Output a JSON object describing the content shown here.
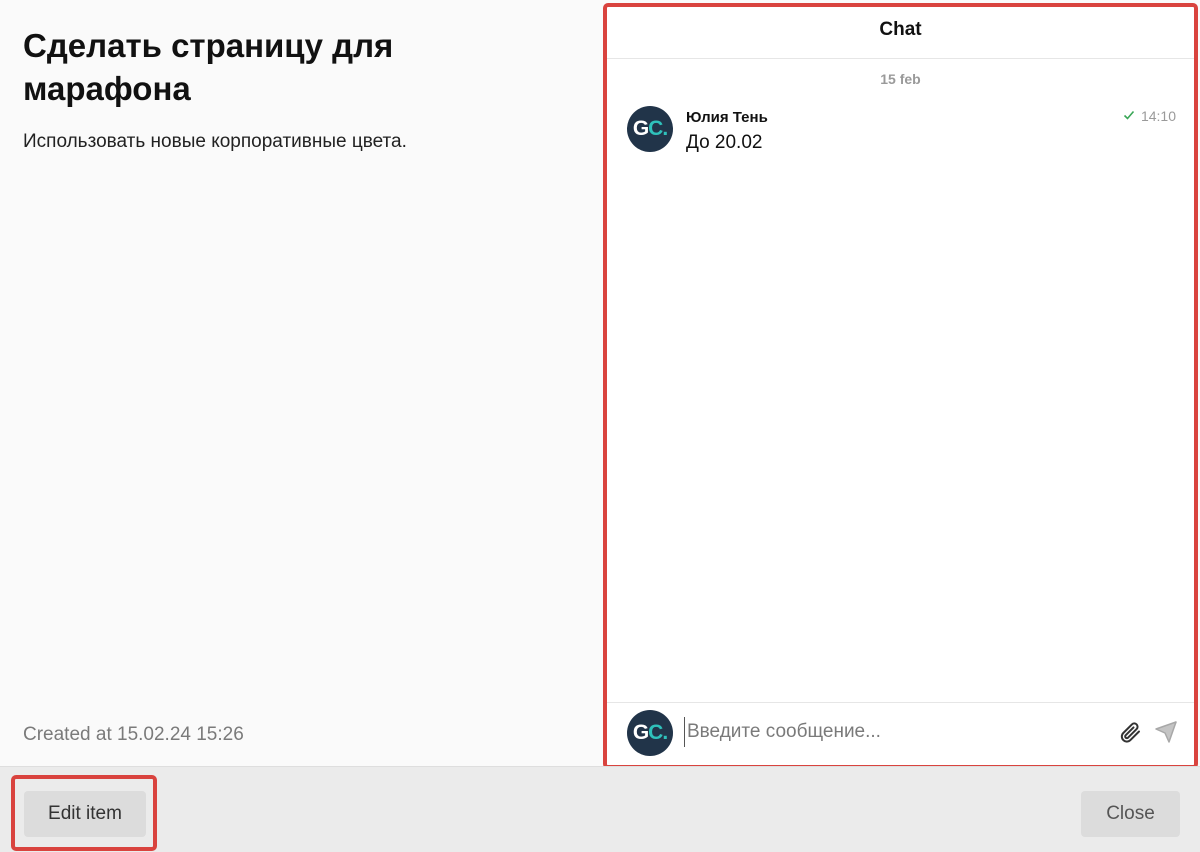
{
  "task": {
    "title": "Сделать страницу для марафона",
    "description": "Использовать новые корпоративные цвета.",
    "created_at": "Created at 15.02.24 15:26"
  },
  "chat": {
    "header": "Chat",
    "date_divider": "15 feb",
    "messages": [
      {
        "author": "Юлия Тень",
        "text": "До 20.02",
        "time": "14:10",
        "status_icon": "check-icon"
      }
    ],
    "avatar_text": "GC.",
    "composer": {
      "placeholder": "Введите сообщение...",
      "value": ""
    }
  },
  "footer": {
    "edit_label": "Edit item",
    "close_label": "Close"
  },
  "colors": {
    "highlight": "#d9433e",
    "avatar_bg": "#213449",
    "avatar_accent": "#2fc1bb",
    "check": "#3aa757"
  }
}
